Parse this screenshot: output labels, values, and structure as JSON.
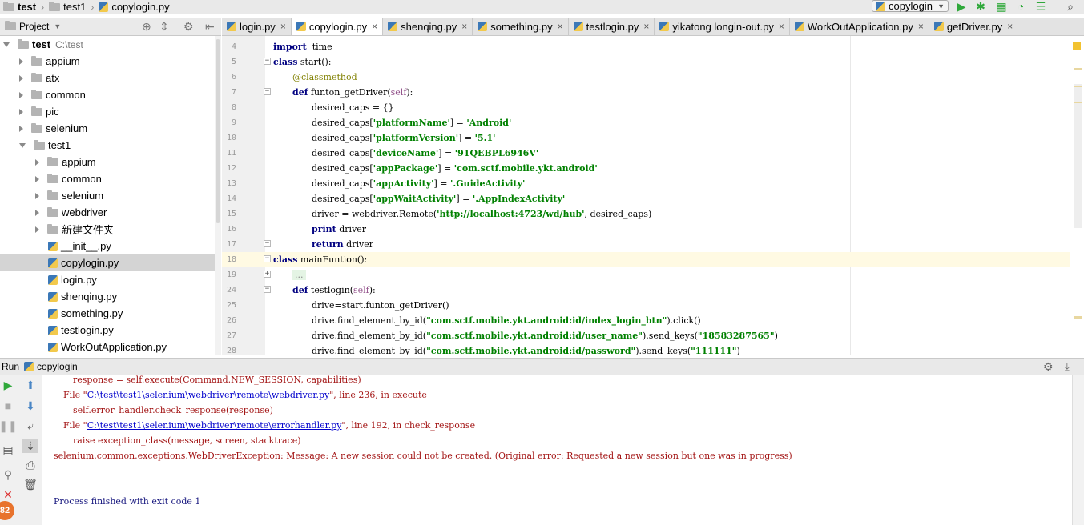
{
  "breadcrumb": {
    "root": "test",
    "folder": "test1",
    "file": "copylogin.py"
  },
  "run_config": {
    "label": "copylogin"
  },
  "project_panel": {
    "title": "Project"
  },
  "tree": [
    {
      "label": "test",
      "path": "C:\\test",
      "level": 0,
      "type": "folder",
      "expanded": true,
      "bold": true
    },
    {
      "label": "appium",
      "level": 1,
      "type": "folder",
      "expanded": false
    },
    {
      "label": "atx",
      "level": 1,
      "type": "folder",
      "expanded": false
    },
    {
      "label": "common",
      "level": 1,
      "type": "folder",
      "expanded": false
    },
    {
      "label": "pic",
      "level": 1,
      "type": "folder",
      "expanded": false
    },
    {
      "label": "selenium",
      "level": 1,
      "type": "folder",
      "expanded": false
    },
    {
      "label": "test1",
      "level": 1,
      "type": "folder",
      "expanded": true
    },
    {
      "label": "appium",
      "level": 2,
      "type": "folder",
      "expanded": false
    },
    {
      "label": "common",
      "level": 2,
      "type": "folder",
      "expanded": false
    },
    {
      "label": "selenium",
      "level": 2,
      "type": "folder",
      "expanded": false
    },
    {
      "label": "webdriver",
      "level": 2,
      "type": "folder",
      "expanded": false
    },
    {
      "label": "新建文件夹",
      "level": 2,
      "type": "folder",
      "expanded": false
    },
    {
      "label": "__init__.py",
      "level": 2,
      "type": "file"
    },
    {
      "label": "copylogin.py",
      "level": 2,
      "type": "file",
      "selected": true
    },
    {
      "label": "login.py",
      "level": 2,
      "type": "file"
    },
    {
      "label": "shenqing.py",
      "level": 2,
      "type": "file"
    },
    {
      "label": "something.py",
      "level": 2,
      "type": "file"
    },
    {
      "label": "testlogin.py",
      "level": 2,
      "type": "file"
    },
    {
      "label": "WorkOutApplication.py",
      "level": 2,
      "type": "file"
    }
  ],
  "tabs": [
    {
      "label": "login.py",
      "active": false
    },
    {
      "label": "copylogin.py",
      "active": true
    },
    {
      "label": "shenqing.py",
      "active": false
    },
    {
      "label": "something.py",
      "active": false
    },
    {
      "label": "testlogin.py",
      "active": false
    },
    {
      "label": "yikatong longin-out.py",
      "active": false
    },
    {
      "label": "WorkOutApplication.py",
      "active": false
    },
    {
      "label": "getDriver.py",
      "active": false
    }
  ],
  "code_lines": [
    {
      "n": "4",
      "fold": "",
      "indent": 0,
      "html": "<span class='kw'>import</span>  time"
    },
    {
      "n": "5",
      "fold": "-",
      "indent": 0,
      "html": "<span class='kw'>class</span> start():"
    },
    {
      "n": "6",
      "fold": "",
      "indent": 1,
      "html": "<span class='dec'>@classmethod</span>"
    },
    {
      "n": "7",
      "fold": "-",
      "indent": 1,
      "html": "<span class='kw'>def</span> funton_getDriver(<span class='slf'>self</span>):"
    },
    {
      "n": "8",
      "fold": "",
      "indent": 2,
      "html": "desired_caps = {}"
    },
    {
      "n": "9",
      "fold": "",
      "indent": 2,
      "html": "desired_caps[<span class='str'>'platformName'</span>] = <span class='str'>'Android'</span>"
    },
    {
      "n": "10",
      "fold": "",
      "indent": 2,
      "html": "desired_caps[<span class='str'>'platformVersion'</span>] = <span class='str'>'5.1'</span>"
    },
    {
      "n": "11",
      "fold": "",
      "indent": 2,
      "html": "desired_caps[<span class='str'>'deviceName'</span>] = <span class='str'>'91QEBPL6946V'</span>"
    },
    {
      "n": "12",
      "fold": "",
      "indent": 2,
      "html": "desired_caps[<span class='str'>'appPackage'</span>] = <span class='str'>'com.sctf.mobile.ykt.android'</span>"
    },
    {
      "n": "13",
      "fold": "",
      "indent": 2,
      "html": "desired_caps[<span class='str'>'appActivity'</span>] = <span class='str'>'.GuideActivity'</span>"
    },
    {
      "n": "14",
      "fold": "",
      "indent": 2,
      "html": "desired_caps[<span class='str'>'appWaitActivity'</span>] = <span class='str'>'.AppIndexActivity'</span>"
    },
    {
      "n": "15",
      "fold": "",
      "indent": 2,
      "html": "driver = webdriver.Remote(<span class='str'>'http://localhost:4723/wd/hub'</span>, desired_caps)"
    },
    {
      "n": "16",
      "fold": "",
      "indent": 2,
      "html": "<span class='kw'>print</span> driver"
    },
    {
      "n": "17",
      "fold": "-",
      "indent": 2,
      "html": "<span class='kw'>return</span> driver"
    },
    {
      "n": "18",
      "fold": "-",
      "indent": 0,
      "html": "<span class='kw'>class</span> mainFuntion():",
      "current": true
    },
    {
      "n": "19",
      "fold": "+",
      "indent": 1,
      "html": "<span class='fold-dots'>...</span>"
    },
    {
      "n": "24",
      "fold": "-",
      "indent": 1,
      "html": "<span class='kw'>def</span> testlogin(<span class='slf'>self</span>):"
    },
    {
      "n": "25",
      "fold": "",
      "indent": 2,
      "html": "drive=start.funton_getDriver()"
    },
    {
      "n": "26",
      "fold": "",
      "indent": 2,
      "html": "drive.find_element_by_id(<span class='str'>\"com.sctf.mobile.ykt.android:id/index_login_btn\"</span>).click()"
    },
    {
      "n": "27",
      "fold": "",
      "indent": 2,
      "html": "drive.find_element_by_id(<span class='str'>\"com.sctf.mobile.ykt.android:id/user_name\"</span>).send_keys(<span class='str'>\"18583287565\"</span>)"
    },
    {
      "n": "28",
      "fold": "",
      "indent": 2,
      "html": "drive.find_element_by_id(<span class='str'>\"com.sctf.mobile.ykt.android:id/password\"</span>).send_keys(<span class='str'>\"111111\"</span>)"
    }
  ],
  "run_panel": {
    "title": "Run",
    "config": "copylogin"
  },
  "console_lines": [
    {
      "indent": 2,
      "html": "response = self.execute(Command.NEW_SESSION, capabilities)"
    },
    {
      "indent": 1,
      "html": "File \"<a>C:\\test\\test1\\selenium\\webdriver\\remote\\webdriver.py</a>\", line 236, in execute"
    },
    {
      "indent": 2,
      "html": "self.error_handler.check_response(response)"
    },
    {
      "indent": 1,
      "html": "File \"<a>C:\\test\\test1\\selenium\\webdriver\\remote\\errorhandler.py</a>\", line 192, in check_response"
    },
    {
      "indent": 2,
      "html": "raise exception_class(message, screen, stacktrace)"
    },
    {
      "indent": 0,
      "html": "selenium.common.exceptions.WebDriverException: Message: A new session could not be created. (Original error: Requested a new session but one was in progress)"
    },
    {
      "indent": 0,
      "html": ""
    },
    {
      "indent": 0,
      "html": ""
    },
    {
      "indent": 0,
      "html": "Process finished with exit code 1",
      "exit": true
    }
  ],
  "badge": {
    "text": "82"
  },
  "colors": {
    "keyword": "#000080",
    "string": "#008000",
    "current_line": "#fffae3",
    "error_text": "#a31515"
  }
}
